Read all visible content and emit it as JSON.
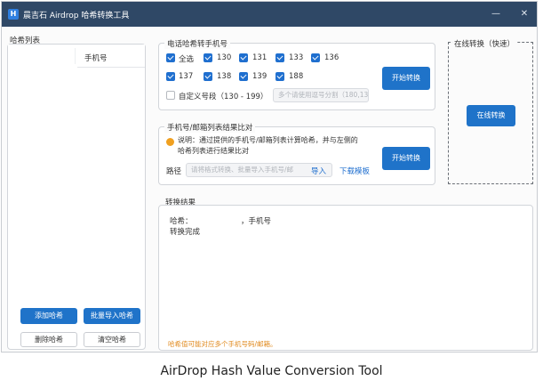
{
  "window": {
    "title": "晨吉石 Airdrop 哈希转换工具",
    "icon_letter": "H",
    "minimize": "—",
    "close": "✕"
  },
  "hash_list": {
    "title": "哈希列表",
    "column_header": "手机号",
    "buttons": {
      "add": "添加哈希",
      "batch_import": "批量导入哈希",
      "delete": "删除哈希",
      "clear": "清空哈希"
    }
  },
  "phone_group": {
    "title": "电话哈希转手机号",
    "checkboxes": [
      {
        "label": "全选",
        "checked": true
      },
      {
        "label": "130",
        "checked": true
      },
      {
        "label": "131",
        "checked": true
      },
      {
        "label": "133",
        "checked": true
      },
      {
        "label": "136",
        "checked": true
      },
      {
        "label": "137",
        "checked": true
      },
      {
        "label": "138",
        "checked": true
      },
      {
        "label": "139",
        "checked": true
      },
      {
        "label": "188",
        "checked": true
      }
    ],
    "custom": {
      "label": "自定义号段（130 - 199）",
      "checked": false,
      "placeholder": "多个请使用逗号分割（180,13..."
    },
    "start_button": "开始转换"
  },
  "compare_group": {
    "title": "手机号/邮箱列表结果比对",
    "note": "说明：通过提供的手机号/邮箱列表计算哈希，并与左侧的哈希列表进行结果比对",
    "path_label": "路径",
    "path_placeholder": "请将格式转换、批量导入手机号/邮",
    "import_button": "导入",
    "download_link": "下载模板",
    "start_button": "开始转换"
  },
  "online_group": {
    "title": "在线转换（快速）",
    "button": "在线转换"
  },
  "result_group": {
    "title": "转换结果",
    "line1_prefix": "哈希：",
    "line1_suffix": "，手机号",
    "line2": "转换完成",
    "footer_note": "哈希值可能对应多个手机号码/邮箱。"
  },
  "caption": "AirDrop Hash Value Conversion Tool",
  "colors": {
    "titlebar": "#2f4866",
    "accent": "#1f73c9",
    "warning": "#f0a020",
    "note_orange": "#e08a1e"
  }
}
